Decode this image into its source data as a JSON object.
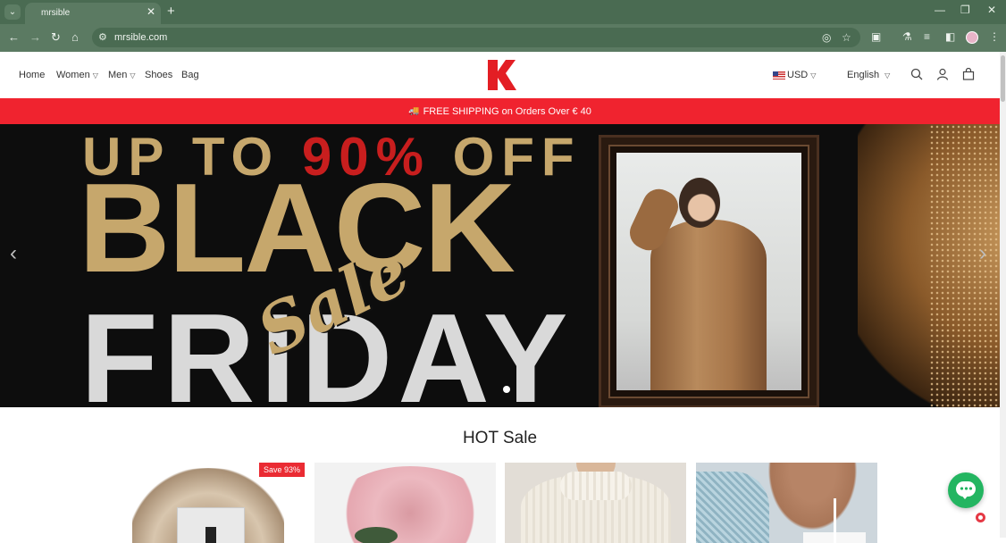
{
  "browser": {
    "tab_title": "mrsible",
    "url": "mrsible.com",
    "new_tab_symbol": "+",
    "close_symbol": "✕"
  },
  "header": {
    "nav": [
      {
        "label": "Home"
      },
      {
        "label": "Women"
      },
      {
        "label": "Men"
      },
      {
        "label": "Shoes"
      },
      {
        "label": "Bag"
      }
    ],
    "logo_letter": "K",
    "currency": "USD",
    "language": "English"
  },
  "promo": {
    "text": "FREE SHIPPING on Orders Over € 40"
  },
  "hero": {
    "line1_a": "UP TO ",
    "line1_b": "90%",
    "line1_c": " OFF",
    "line2": "BLACK",
    "script": "Sale",
    "line3": "FRIDAY"
  },
  "hot_sale": {
    "title": "HOT Sale",
    "products": [
      {
        "badge": "Save 93%"
      },
      {
        "badge": ""
      },
      {
        "badge": ""
      },
      {
        "badge": ""
      }
    ]
  },
  "colors": {
    "promo_bar": "#f0232f",
    "logo_red": "#e31e24",
    "chrome": "#5b7a62",
    "chat_green": "#23b561",
    "gold": "#c6a76c"
  },
  "icons": [
    "tab-menu-icon",
    "back-icon",
    "forward-icon",
    "reload-icon",
    "home-icon",
    "site-info-icon",
    "eye-off-icon",
    "star-icon",
    "extensions-icon",
    "labs-icon",
    "media-icon",
    "sidebar-icon",
    "menu-icon",
    "search-icon",
    "account-icon",
    "cart-icon",
    "chat-icon"
  ]
}
